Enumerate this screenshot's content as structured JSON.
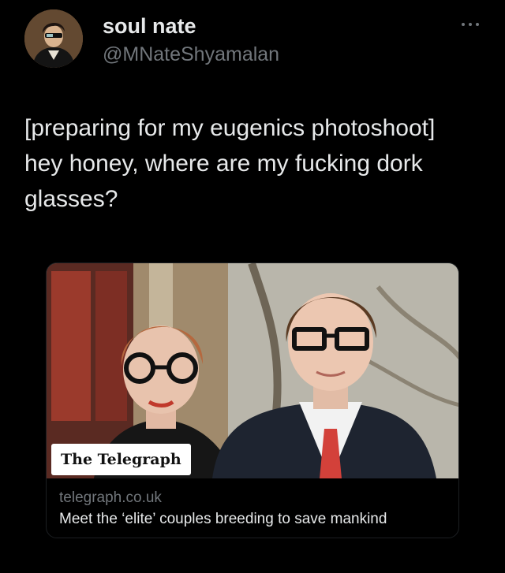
{
  "author": {
    "display_name": "soul nate",
    "handle": "@MNateShyamalan",
    "avatar_icon": "portrait-avatar"
  },
  "menu": {
    "icon": "more-icon"
  },
  "tweet": {
    "lines": [
      "[preparing for my eugenics photoshoot]",
      "hey honey, where are my fucking dork",
      "glasses?"
    ]
  },
  "link_card": {
    "source_badge": "The Telegraph",
    "domain": "telegraph.co.uk",
    "title": "Meet the ‘elite’ couples breeding to save mankind"
  },
  "colors": {
    "background": "#000000",
    "text_primary": "#e7e9ea",
    "text_secondary": "#71767b"
  }
}
